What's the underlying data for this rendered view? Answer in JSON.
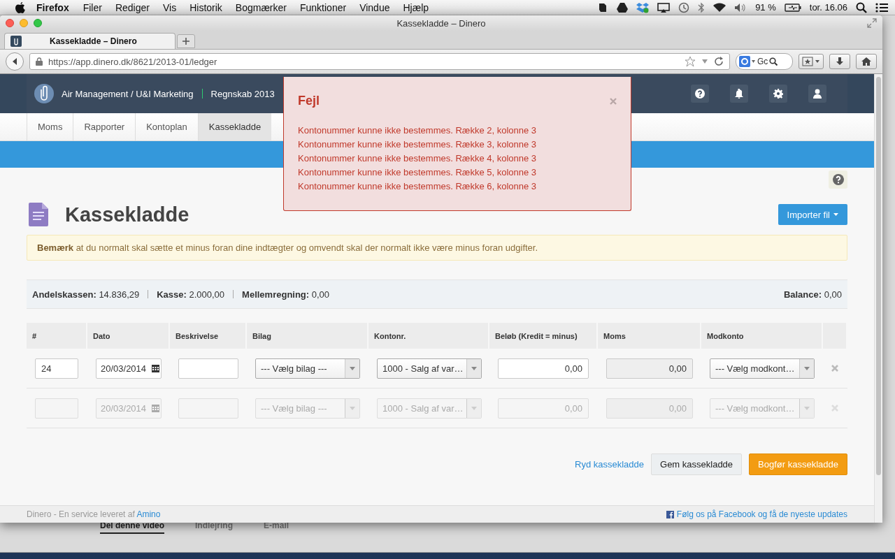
{
  "menubar": {
    "app": "Firefox",
    "menus": [
      "Filer",
      "Rediger",
      "Vis",
      "Historik",
      "Bogmærker",
      "Funktioner",
      "Vindue",
      "Hjælp"
    ],
    "battery": "91 %",
    "clock": "tor. 16.06"
  },
  "browser": {
    "title": "Kassekladde – Dinero",
    "tabs": [
      {
        "label": "Kassekladde – Dinero",
        "selected": true
      }
    ],
    "url": "https://app.dinero.dk/8621/2013-01/ledger",
    "search": {
      "placeholder": "Gc"
    }
  },
  "topnav": {
    "company": "Air Management / U&I Marketing",
    "year": "Regnskab 2013"
  },
  "subnav": [
    {
      "label": "Moms",
      "selected": false
    },
    {
      "label": "Rapporter",
      "selected": false
    },
    {
      "label": "Kontoplan",
      "selected": false
    },
    {
      "label": "Kassekladde",
      "selected": true
    }
  ],
  "page": {
    "title": "Kassekladde",
    "import_button": "Importer fil",
    "notice": "**Bemærk** at du normalt skal sætte et minus foran dine indtægter og omvendt skal der normalt ikke være minus foran udgifter."
  },
  "balances": [
    {
      "label": "Andelskassen:",
      "value": "14.836,29"
    },
    {
      "label": "Kasse:",
      "value": "2.000,00"
    },
    {
      "label": "Mellemregning:",
      "value": "0,00"
    }
  ],
  "balance": {
    "label": "Balance:",
    "value": "0,00"
  },
  "table": {
    "columns": [
      "#",
      "Dato",
      "Beskrivelse",
      "Bilag",
      "Kontonr.",
      "Beløb (Kredit = minus)",
      "Moms",
      "Modkonto"
    ],
    "rows": [
      {
        "disabled": false,
        "number": "24",
        "date": "20/03/2014",
        "voucher": "--- Vælg bilag ---",
        "account": "1000 - Salg af var…",
        "amount": "0,00",
        "vat": "0,00",
        "counter_account": "--- Vælg modkont…"
      },
      {
        "disabled": true,
        "date": "20/03/2014",
        "voucher": "--- Vælg bilag ---",
        "account": "1000 - Salg af var…",
        "amount": "0,00",
        "vat": "0,00",
        "counter_account": "--- Vælg modkont…"
      }
    ]
  },
  "actions": {
    "clear_link": "Ryd kassekladde",
    "save_button": "Gem kassekladde",
    "post_button": "Bogfør kassekladde"
  },
  "footer": {
    "text": "Dinero - En service leveret af",
    "link": "Amino",
    "social": "Følg os på Facebook og få de nyeste updates"
  },
  "error_dialog": {
    "title": "Fejl",
    "messages": [
      "Kontonummer kunne ikke bestemmes. Række 2, kolonne 3",
      "Kontonummer kunne ikke bestemmes. Række 3, kolonne 3",
      "Kontonummer kunne ikke bestemmes. Række 4, kolonne 3",
      "Kontonummer kunne ikke bestemmes. Række 5, kolonne 3",
      "Kontonummer kunne ikke bestemmes. Række 6, kolonne 3"
    ]
  },
  "background_window": {
    "tabs": [
      {
        "label": "Del denne video",
        "selected": true
      },
      {
        "label": "Indlejring",
        "selected": false
      },
      {
        "label": "E-mail",
        "selected": false
      }
    ]
  }
}
